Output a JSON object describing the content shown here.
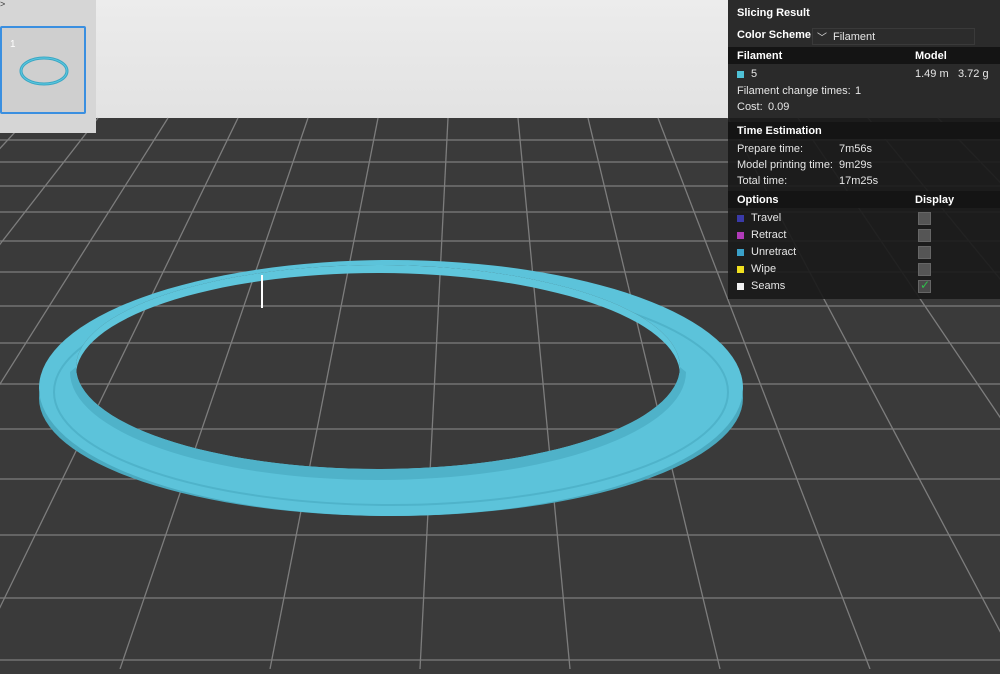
{
  "window": {
    "corner_glyph": ">"
  },
  "plate": {
    "number": "1"
  },
  "panel": {
    "title": "Slicing Result",
    "color_scheme": {
      "label": "Color Scheme",
      "value": "Filament"
    },
    "filament": {
      "header": "Filament",
      "model_header": "Model",
      "name": "5",
      "swatch": "#4fc1d6",
      "length": "1.49 m",
      "weight": "3.72 g",
      "change_label": "Filament change times:",
      "change_value": "1",
      "cost_label": "Cost:",
      "cost_value": "0.09"
    },
    "time": {
      "header": "Time Estimation",
      "prepare_label": "Prepare time:",
      "prepare_value": "7m56s",
      "model_label": "Model printing time:",
      "model_value": "9m29s",
      "total_label": "Total time:",
      "total_value": "17m25s"
    },
    "options": {
      "header": "Options",
      "display_header": "Display",
      "items": [
        {
          "label": "Travel",
          "color": "#3a3aa8",
          "checked": false
        },
        {
          "label": "Retract",
          "color": "#b03ab8",
          "checked": false
        },
        {
          "label": "Unretract",
          "color": "#3aa0c8",
          "checked": false
        },
        {
          "label": "Wipe",
          "color": "#f0e020",
          "checked": false
        },
        {
          "label": "Seams",
          "color": "#f2f2f2",
          "checked": true
        }
      ]
    }
  },
  "colors": {
    "model": "#58bfd6",
    "bed": "#3a3a3a",
    "grid": "#7a7a7a",
    "accent": "#3a8fe0"
  }
}
